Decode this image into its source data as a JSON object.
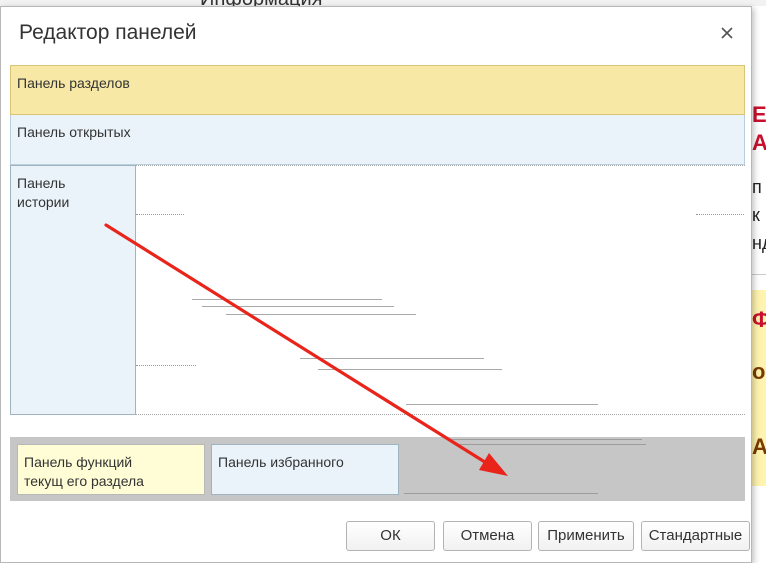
{
  "background": {
    "window_title": "Информация",
    "right_edge": {
      "red_lines": [
        "Е",
        "А"
      ],
      "black_lines": [
        "п",
        "к",
        "нд"
      ],
      "yellow_lines": [
        "Ф",
        "о",
        "АГ"
      ]
    }
  },
  "dialog": {
    "title": "Редактор панелей",
    "close_icon": "close-icon",
    "panels": {
      "sections": "Панель разделов",
      "open": "Панель открытых",
      "history": "Панель\nистории",
      "functions": "Панель функций\nтекущ его раздела",
      "favorites": "Панель избранного"
    },
    "buttons": {
      "ok": "ОК",
      "cancel": "Отмена",
      "apply": "Применить",
      "standard": "Стандартные"
    }
  },
  "colors": {
    "sections_panel": "#f8e8a6",
    "open_panel": "#e9f3f9",
    "functions_panel": "#fffdd6",
    "bottom_area": "#c6c6c6",
    "arrow": "#e8241b"
  }
}
